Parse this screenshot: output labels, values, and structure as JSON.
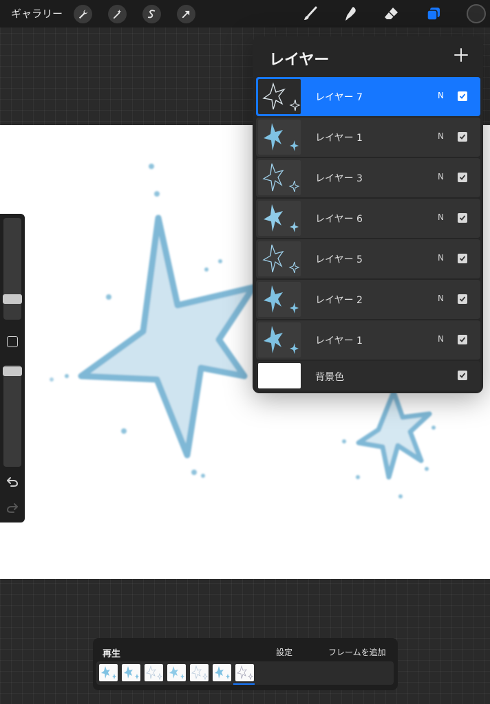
{
  "toolbar": {
    "gallery_label": "ギャラリー",
    "left_tools": [
      "wrench-icon",
      "magic-wand-icon",
      "selection-icon",
      "transform-arrow-icon"
    ],
    "right_tools": [
      "brush-icon",
      "smudge-icon",
      "eraser-icon",
      "layers-icon"
    ],
    "accent_color": "#1677ff"
  },
  "layers_panel": {
    "title": "レイヤー",
    "add_icon": "plus-icon",
    "layers": [
      {
        "name": "レイヤー 7",
        "blend": "N",
        "visible": true,
        "selected": true
      },
      {
        "name": "レイヤー 1",
        "blend": "N",
        "visible": true,
        "selected": false
      },
      {
        "name": "レイヤー 3",
        "blend": "N",
        "visible": true,
        "selected": false
      },
      {
        "name": "レイヤー 6",
        "blend": "N",
        "visible": true,
        "selected": false
      },
      {
        "name": "レイヤー 5",
        "blend": "N",
        "visible": true,
        "selected": false
      },
      {
        "name": "レイヤー 2",
        "blend": "N",
        "visible": true,
        "selected": false
      },
      {
        "name": "レイヤー 1",
        "blend": "N",
        "visible": true,
        "selected": false
      }
    ],
    "background_layer": {
      "name": "背景色",
      "visible": true
    }
  },
  "animation_bar": {
    "play_label": "再生",
    "settings_label": "設定",
    "add_frame_label": "フレームを追加",
    "frame_count": 7,
    "current_frame": 7
  },
  "canvas": {
    "star_fill": "#cfe4f0",
    "star_stroke": "#7fb8d6"
  }
}
